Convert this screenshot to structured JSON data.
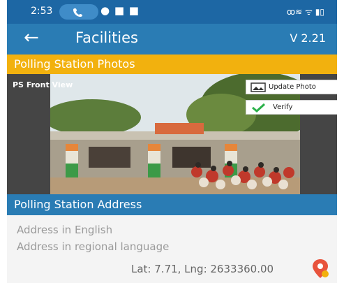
{
  "status_bar": {
    "time": "2:53",
    "right_icons": "ꝏ≋ ᯤ ▮▯"
  },
  "app_bar": {
    "back_icon": "arrow-left-icon",
    "title": "Facilities",
    "version": "V 2.21"
  },
  "photo_section": {
    "title": "Polling Station Photos",
    "photo_label": "PS Front View",
    "update_label": "Update Photo",
    "verify_label": "Verify"
  },
  "address_section": {
    "title": "Polling Station Address",
    "english": "Address in English",
    "regional": "Address in regional language",
    "coords": "Lat: 7.71, Lng: 2633360.00"
  },
  "colors": {
    "statusbar": "#1d67a4",
    "appbar": "#2a7cb4",
    "section_yellow": "#f2b10e",
    "section_blue": "#2a7cb4",
    "verify_check": "#2bb14a",
    "pin": "#e8533c"
  }
}
